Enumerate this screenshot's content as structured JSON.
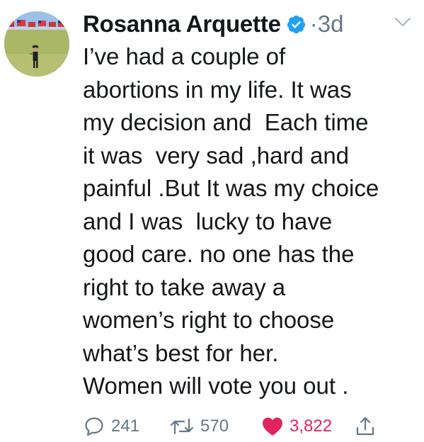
{
  "author": {
    "display_name": "Rosanna Arquette",
    "verified": true,
    "separator": "·",
    "timestamp": "3d"
  },
  "tweet": {
    "lines": [
      "I’ve had a couple of",
      "abortions in my life. It was",
      "my decision and  Each time",
      "it was  very sad ,hard and",
      "painful .But It was my choice",
      "and I was  lucky to have",
      "good care. no one has the",
      "right to take away a",
      "women’s right to choose",
      "what’s best for her.",
      "Women will vote you out ."
    ]
  },
  "actions": {
    "reply_count": "241",
    "retweet_count": "570",
    "like_count": "3,822",
    "like_active": true
  },
  "icons": {
    "reply": "comment-bubble-icon",
    "retweet": "retweet-icon",
    "like": "heart-icon",
    "share": "share-icon",
    "verified": "verified-badge-icon",
    "menu": "chevron-down-icon"
  },
  "colors": {
    "text": "#14171a",
    "muted": "#657786",
    "verified_blue": "#1da1f2",
    "like_red": "#e0245e"
  }
}
